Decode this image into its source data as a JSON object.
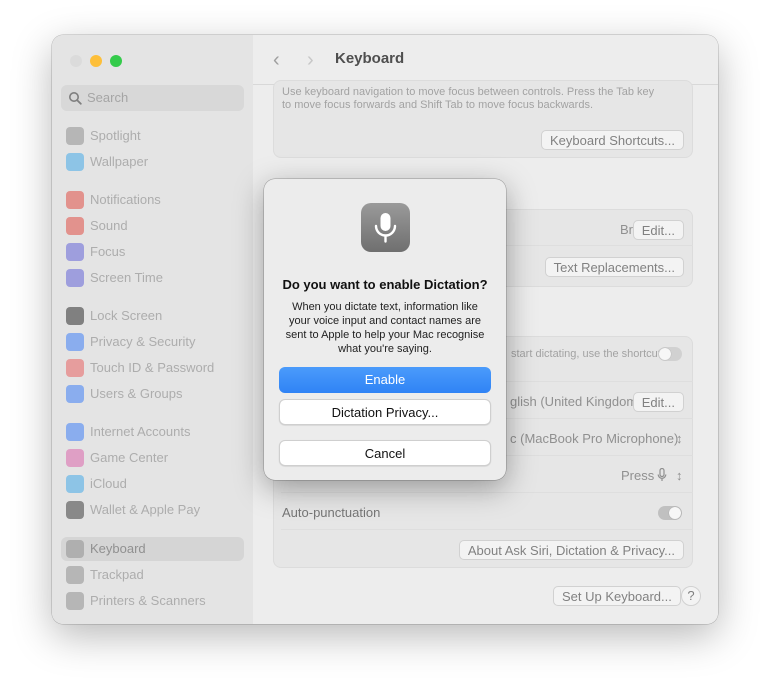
{
  "window": {
    "title": "Keyboard"
  },
  "search": {
    "placeholder": "Search"
  },
  "sidebar": {
    "groups": [
      [
        {
          "label": "Spotlight",
          "icon": "spotlight-icon",
          "color": "#8a8a8a"
        },
        {
          "label": "Wallpaper",
          "icon": "wallpaper-icon",
          "color": "#3aa6e8"
        }
      ],
      [
        {
          "label": "Notifications",
          "icon": "notifications-icon",
          "color": "#e0453a"
        },
        {
          "label": "Sound",
          "icon": "sound-icon",
          "color": "#e0453a"
        },
        {
          "label": "Focus",
          "icon": "focus-icon",
          "color": "#5b5bd6"
        },
        {
          "label": "Screen Time",
          "icon": "screen-time-icon",
          "color": "#5b5bd6"
        }
      ],
      [
        {
          "label": "Lock Screen",
          "icon": "lock-icon",
          "color": "#222222"
        },
        {
          "label": "Privacy & Security",
          "icon": "privacy-hand-icon",
          "color": "#3478f6"
        },
        {
          "label": "Touch ID & Password",
          "icon": "fingerprint-icon",
          "color": "#e85a5a"
        },
        {
          "label": "Users & Groups",
          "icon": "users-icon",
          "color": "#3478f6"
        }
      ],
      [
        {
          "label": "Internet Accounts",
          "icon": "at-icon",
          "color": "#3478f6"
        },
        {
          "label": "Game Center",
          "icon": "game-center-icon",
          "color": "#d85fa8"
        },
        {
          "label": "iCloud",
          "icon": "cloud-icon",
          "color": "#3aa6e8"
        },
        {
          "label": "Wallet & Apple Pay",
          "icon": "wallet-icon",
          "color": "#333333"
        }
      ],
      [
        {
          "label": "Keyboard",
          "icon": "keyboard-icon",
          "color": "#8a8a8a",
          "active": true
        },
        {
          "label": "Trackpad",
          "icon": "trackpad-icon",
          "color": "#8a8a8a"
        },
        {
          "label": "Printers & Scanners",
          "icon": "printer-icon",
          "color": "#8a8a8a"
        }
      ]
    ]
  },
  "content": {
    "nav_description": "Use keyboard navigation to move focus between controls. Press the Tab key to move focus forwards and Shift Tab to move focus backwards.",
    "keyboard_shortcuts_button": "Keyboard Shortcuts...",
    "input_source_value": "British",
    "edit_button": "Edit...",
    "text_replacements_button": "Text Replacements...",
    "dictation_hint": "start dictating, use the shortcut",
    "language_value": "glish (United Kingdom)",
    "microphone_value": "c (MacBook Pro Microphone)",
    "shortcut_value": "Press",
    "auto_punctuation_label": "Auto-punctuation",
    "about_siri_button": "About Ask Siri, Dictation & Privacy...",
    "setup_keyboard_button": "Set Up Keyboard...",
    "help_button": "?"
  },
  "dialog": {
    "icon": "microphone-icon",
    "title": "Do you want to enable Dictation?",
    "message": "When you dictate text, information like your voice input and contact names are sent to Apple to help your Mac recognise what you're saying.",
    "enable_button": "Enable",
    "privacy_button": "Dictation Privacy...",
    "cancel_button": "Cancel",
    "accent_color": "#3b8af7"
  }
}
